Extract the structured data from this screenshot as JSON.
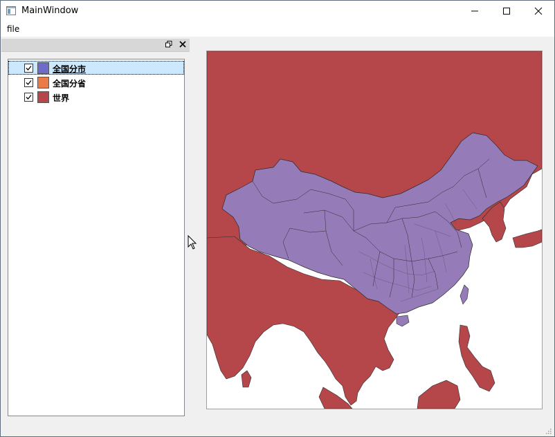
{
  "window": {
    "title": "MainWindow"
  },
  "menu": {
    "items": [
      "file"
    ]
  },
  "layers": [
    {
      "label": "全国分市",
      "color": "#6d6dc9",
      "checked": true,
      "selected": true
    },
    {
      "label": "全国分省",
      "color": "#ea7a48",
      "checked": true,
      "selected": false
    },
    {
      "label": "世界",
      "color": "#b5474b",
      "checked": true,
      "selected": false
    }
  ],
  "map": {
    "world_color": "#b5474b",
    "china_color": "#957bb8",
    "water_color": "#ffffff",
    "boundary_color": "#2b2b2b"
  },
  "icons": {
    "app": "app-window-icon",
    "minimize": "minimize-icon",
    "maximize": "maximize-icon",
    "close": "close-icon",
    "dock_float": "dock-float-icon",
    "dock_close": "dock-close-icon",
    "check": "check-icon",
    "cursor": "arrow-cursor-icon"
  }
}
